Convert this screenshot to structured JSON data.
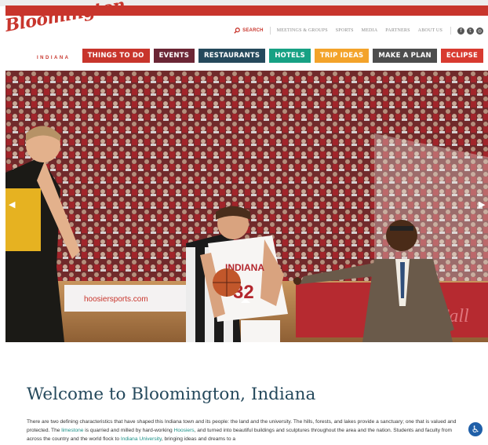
{
  "brand": {
    "script_name": "Bloomington",
    "sub_name": "INDIANA",
    "color": "#c8352c"
  },
  "utility_nav": {
    "search_label": "SEARCH",
    "links": [
      "MEETINGS & GROUPS",
      "SPORTS",
      "MEDIA",
      "PARTNERS",
      "ABOUT US"
    ],
    "social_icons": [
      "facebook-icon",
      "twitter-icon",
      "instagram-icon"
    ]
  },
  "main_nav": [
    {
      "label": "THINGS TO DO",
      "color": "#c8352c"
    },
    {
      "label": "EVENTS",
      "color": "#6b2635"
    },
    {
      "label": "RESTAURANTS",
      "color": "#25495c"
    },
    {
      "label": "HOTELS",
      "color": "#17a184"
    },
    {
      "label": "TRIP IDEAS",
      "color": "#f3a32a"
    },
    {
      "label": "MAKE A PLAN",
      "color": "#4d4d4d"
    },
    {
      "label": "ECLIPSE",
      "color": "#d83a30"
    }
  ],
  "hero": {
    "jersey_text": "INDIANA",
    "jersey_number": "32",
    "courtside_text": "hoosiersports.com",
    "board_text": "OnCall"
  },
  "welcome": {
    "title": "Welcome to Bloomington, Indiana",
    "p_1": "There are two defining characteristics that have shaped this Indiana town and its people: the land and the university. The hills, forests, and lakes provide a sanctuary; one that is valued and protected. The ",
    "link_1": "limestone",
    "p_2": " is quarried and milled by hard-working ",
    "link_2": "Hoosiers",
    "p_3": ", and turned into beautiful buildings and sculptures throughout the area and the nation. Students and faculty from across the country and the world flock to ",
    "link_3": "Indiana University",
    "p_4": ", bringing ideas and dreams to a"
  }
}
